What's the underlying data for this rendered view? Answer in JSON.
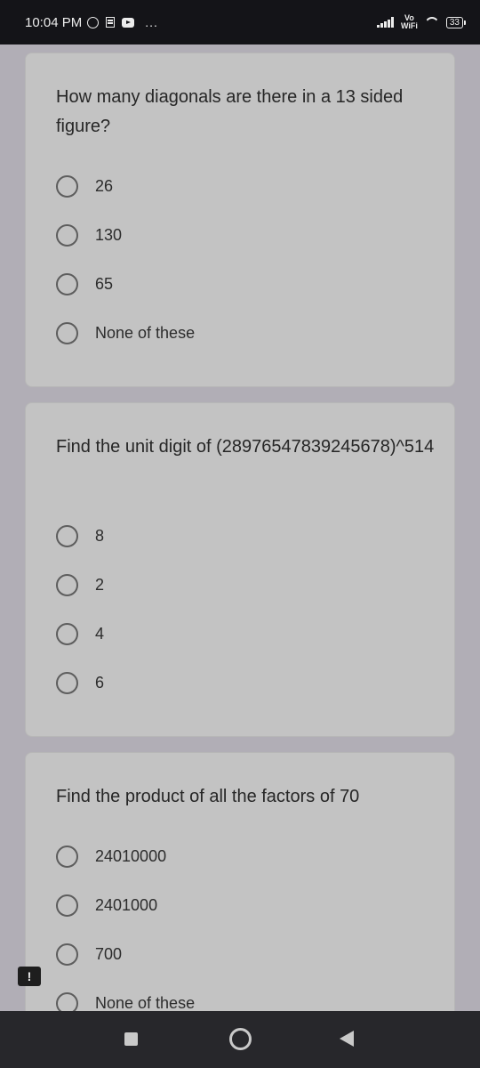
{
  "status_bar": {
    "time": "10:04 PM",
    "network_label_top": "Vo",
    "network_label_bottom": "WiFi",
    "battery": "33",
    "more": "..."
  },
  "questions": [
    {
      "text": "How many diagonals are there in a 13 sided figure?",
      "options": [
        "26",
        "130",
        "65",
        "None of these"
      ]
    },
    {
      "text": "Find the unit digit of (28976547839245678)^514",
      "options": [
        "8",
        "2",
        "4",
        "6"
      ]
    },
    {
      "text": "Find the product of all the factors  of 70",
      "options": [
        "24010000",
        "2401000",
        "700",
        "None of these"
      ]
    }
  ],
  "alert_badge": "!",
  "icons": {
    "whatsapp": "whatsapp-icon",
    "document": "document-icon",
    "youtube": "youtube-icon",
    "signal": "signal-icon",
    "wifi": "wifi-icon",
    "battery": "battery-icon",
    "nav_recents": "recents-icon",
    "nav_home": "home-icon",
    "nav_back": "back-icon"
  }
}
